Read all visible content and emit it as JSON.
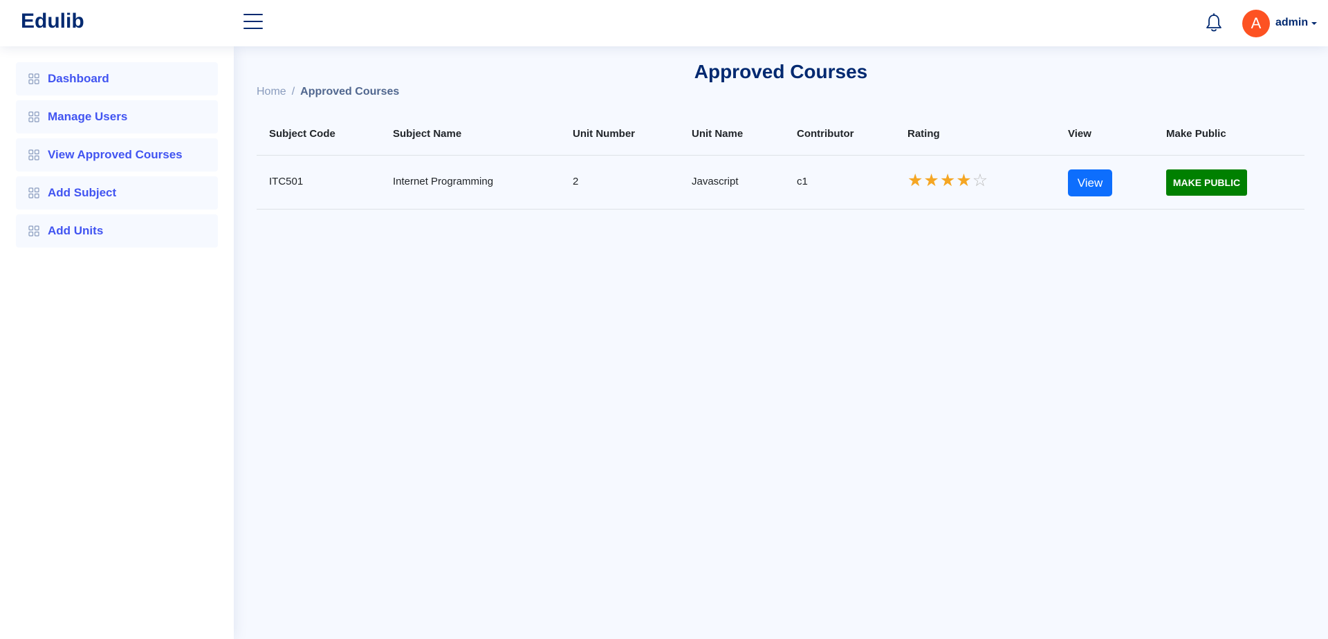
{
  "app": {
    "title": "Edulib"
  },
  "header": {
    "menu_icon": "hamburger-icon",
    "notification_icon": "bell-icon",
    "avatar_letter": "A",
    "avatar_color": "#fd5222",
    "user_name": "admin"
  },
  "sidebar": {
    "items": [
      {
        "label": "Dashboard",
        "icon": "grid-icon"
      },
      {
        "label": "Manage Users",
        "icon": "grid-icon"
      },
      {
        "label": "View Approved Courses",
        "icon": "grid-icon"
      },
      {
        "label": "Add Subject",
        "icon": "grid-icon"
      },
      {
        "label": "Add Units",
        "icon": "grid-icon"
      }
    ]
  },
  "main": {
    "title": "Approved Courses",
    "breadcrumb": {
      "home": "Home",
      "separator": "/",
      "current": "Approved Courses"
    },
    "table": {
      "headers": [
        "Subject Code",
        "Subject Name",
        "Unit Number",
        "Unit Name",
        "Contributor",
        "Rating",
        "View",
        "Make Public"
      ],
      "rows": [
        {
          "subject_code": "ITC501",
          "subject_name": "Internet Programming",
          "unit_number": "2",
          "unit_name": "Javascript",
          "contributor": "c1",
          "rating": 4,
          "rating_max": 5,
          "view_label": "View",
          "make_public_label": "MAKE PUBLIC"
        }
      ]
    }
  },
  "colors": {
    "brand": "#012970",
    "accent": "#4154f1",
    "primary_button": "#0d6efd",
    "public_button": "#008000",
    "star": "#f5a623"
  }
}
